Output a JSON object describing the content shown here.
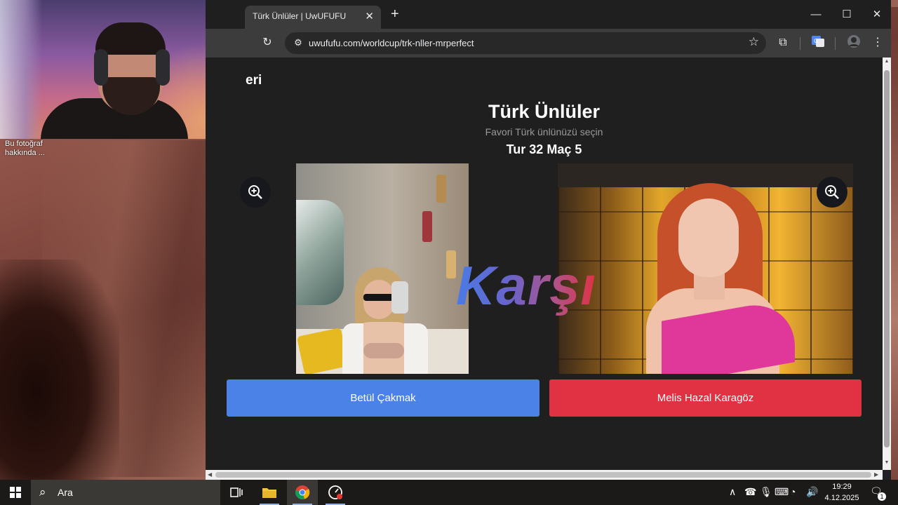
{
  "webcam": {
    "caption": "Bu fotoğraf\nhakkında ..."
  },
  "browser": {
    "tab_title": "Türk Ünlüler | UwUFUFU",
    "tab_close": "✕",
    "new_tab": "+",
    "window_controls": {
      "minimize": "—",
      "maximize": "☐",
      "close": "✕"
    },
    "url": "uwufufu.com/worldcup/trk-nller-mrperfect"
  },
  "page": {
    "partial_heading": "eri",
    "title": "Türk Ünlüler",
    "subtitle": "Favori Türk ünlünüzü seçin",
    "round": "Tur 32 Maç 5",
    "versus": "Karşı",
    "left_choice": "Betül Çakmak",
    "right_choice": "Melis Hazal Karagöz",
    "colors": {
      "left_button": "#4a82e8",
      "right_button": "#e03242",
      "background": "#1f1f1f"
    }
  },
  "taskbar": {
    "search_placeholder": "Ara",
    "time": "19:29",
    "date": "4.12.2025",
    "notification_count": "1"
  },
  "icons": [
    "windows-icon",
    "search-icon",
    "task-view-icon",
    "file-explorer-icon",
    "chrome-icon",
    "speed-icon",
    "zoom-in-icon",
    "star-icon",
    "extensions-icon",
    "translate-icon",
    "profile-icon",
    "menu-icon",
    "reload-icon",
    "site-settings-icon"
  ]
}
